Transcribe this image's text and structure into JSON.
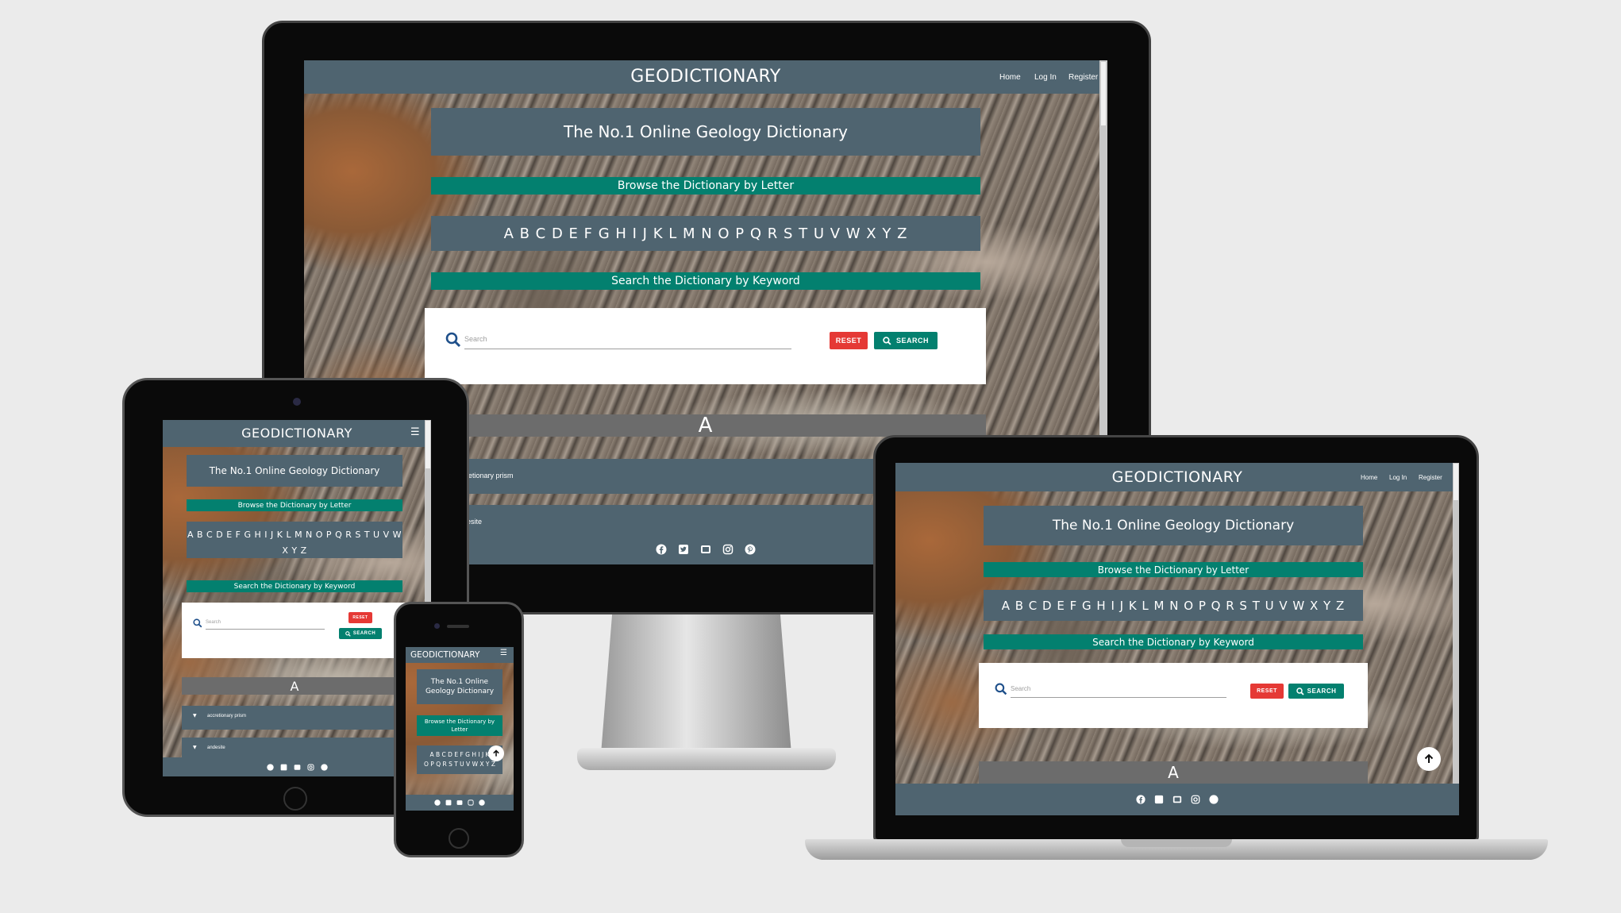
{
  "app": {
    "brand": "GEODICTIONARY",
    "nav": {
      "home": "Home",
      "login": "Log In",
      "register": "Register"
    },
    "hero": "The No.1 Online Geology Dictionary",
    "hero_phone_line1": "The No.1 Online",
    "hero_phone_line2": "Geology Dictionary",
    "browse": "Browse the Dictionary by Letter",
    "browse_phone_line1": "Browse the Dictionary by",
    "browse_phone_line2": "Letter",
    "letters": "A B C D E F G H I J K L M N O P Q R S T U V W X Y Z",
    "letters_tablet_line1": "A B C D E F G H I J K L M N O P Q R S T U V W",
    "letters_tablet_line2": "X Y Z",
    "letters_phone_line1": "A B C D E F G H I J K",
    "letters_phone_line2": "O P Q R S T U V W X Y Z",
    "search_heading": "Search the Dictionary by Keyword",
    "search_placeholder": "Search",
    "reset_label": "RESET",
    "search_label": "SEARCH",
    "section_letter": "A",
    "terms": [
      "accretionary prism",
      "andesite"
    ]
  },
  "colors": {
    "nav": "#4f6470",
    "teal": "#03806f",
    "reset": "#e53935",
    "section": "#6c6c6c",
    "background": "#ebebeb"
  },
  "icons": [
    "facebook-icon",
    "twitter-icon",
    "youtube-icon",
    "instagram-icon",
    "pinterest-icon",
    "search-icon",
    "hamburger-menu-icon",
    "arrow-up-icon",
    "chevron-down-icon"
  ]
}
